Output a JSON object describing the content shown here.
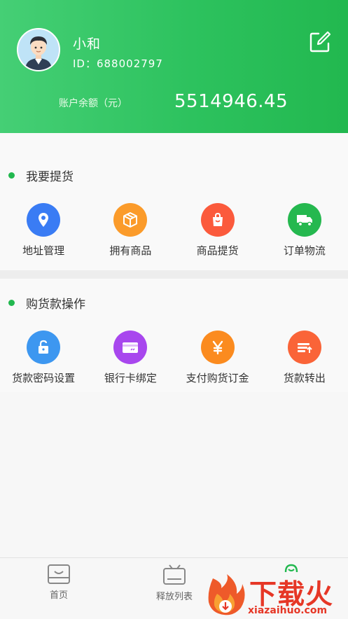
{
  "header": {
    "user_name": "小和",
    "user_id": "ID：688002797",
    "balance_label": "账户余额（元）",
    "balance_value": "5514946.45",
    "edit_icon": "edit-icon"
  },
  "sections": [
    {
      "title": "我要提货",
      "items": [
        {
          "label": "地址管理",
          "icon": "location-pin-icon",
          "color": "#3a7cf4"
        },
        {
          "label": "拥有商品",
          "icon": "box-icon",
          "color": "#fb9b2a"
        },
        {
          "label": "商品提货",
          "icon": "shopping-bag-icon",
          "color": "#fb5a3c"
        },
        {
          "label": "订单物流",
          "icon": "truck-icon",
          "color": "#25b84f"
        }
      ]
    },
    {
      "title": "购货款操作",
      "items": [
        {
          "label": "货款密码设置",
          "icon": "lock-icon",
          "color": "#3d97f0"
        },
        {
          "label": "银行卡绑定",
          "icon": "bank-card-icon",
          "color": "#a847ee"
        },
        {
          "label": "支付购货订金",
          "icon": "yuan-icon",
          "color": "#fb8b1f"
        },
        {
          "label": "货款转出",
          "icon": "transfer-out-icon",
          "color": "#fa6438"
        }
      ]
    }
  ],
  "tabbar": {
    "tabs": [
      {
        "label": "首页",
        "icon": "home-tray-icon"
      },
      {
        "label": "释放列表",
        "icon": "tv-list-icon"
      },
      {
        "label": "",
        "icon": "profile-icon"
      }
    ]
  },
  "watermark": {
    "text": "下载火",
    "domain": "xiazaihuo.com"
  },
  "colors": {
    "header_green_start": "#45cf75",
    "header_green_end": "#22b84f",
    "accent_dot": "#22b84f",
    "watermark_red": "#e63726"
  }
}
